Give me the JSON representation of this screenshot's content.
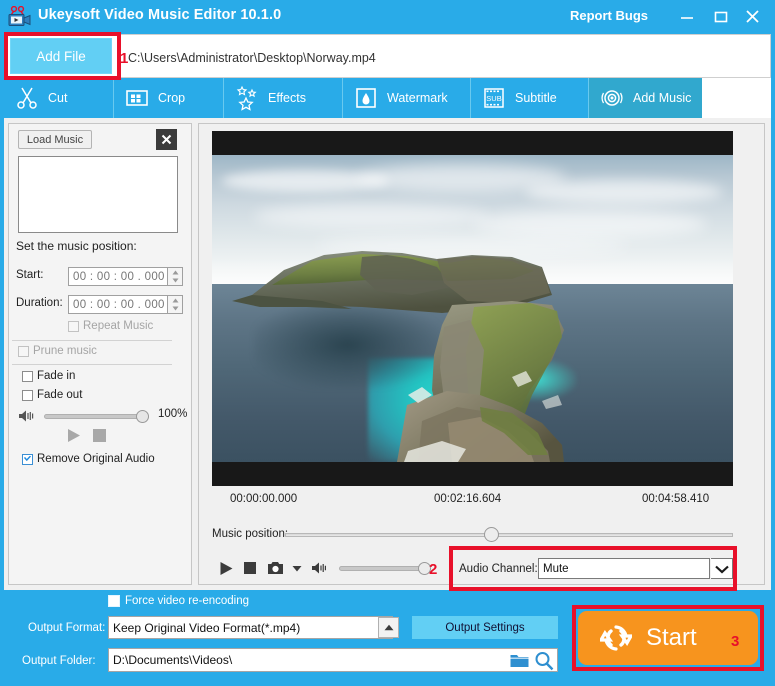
{
  "window": {
    "title": "Ukeysoft Video Music Editor 10.1.0",
    "app_icon": "movie-camera-icon",
    "report_bugs": "Report Bugs",
    "minimize": "minimize-icon",
    "maximize": "maximize-icon",
    "close": "close-icon",
    "header_color": "#29ABE8"
  },
  "file_row": {
    "add_file_label": "Add File",
    "file_path": "C:\\Users\\Administrator\\Desktop\\Norway.mp4"
  },
  "tabs": [
    {
      "label": "Cut",
      "icon": "scissors-icon",
      "active": false
    },
    {
      "label": "Crop",
      "icon": "crop-grid-icon",
      "active": false
    },
    {
      "label": "Effects",
      "icon": "stars-icon",
      "active": false
    },
    {
      "label": "Watermark",
      "icon": "water-drop-icon",
      "active": false
    },
    {
      "label": "Subtitle",
      "icon": "subtitle-film-icon",
      "active": false
    },
    {
      "label": "Add Music",
      "icon": "music-disc-icon",
      "active": true
    }
  ],
  "music_panel": {
    "load_music_label": "Load Music",
    "close_label": "✕",
    "set_position_label": "Set the music position:",
    "start_label": "Start:",
    "start_value": "00 : 00 : 00 . 000",
    "duration_label": "Duration:",
    "duration_value": "00 : 00 : 00 . 000",
    "repeat_music_label": "Repeat Music",
    "repeat_music_checked": false,
    "prune_music_label": "Prune music",
    "prune_music_checked": false,
    "prune_music_disabled": true,
    "fade_in_label": "Fade in",
    "fade_in_checked": false,
    "fade_out_label": "Fade out",
    "fade_out_checked": false,
    "volume_percent": "100%",
    "volume_value": 100,
    "play_icon": "play-icon",
    "stop_icon": "stop-icon",
    "remove_original_audio_label": "Remove Original Audio",
    "remove_original_audio_checked": true
  },
  "preview": {
    "time_start": "00:00:00.000",
    "time_current": "00:02:16.604",
    "time_end": "00:04:58.410",
    "music_position_label": "Music position:",
    "music_position_value": 45,
    "play_icon": "play-icon",
    "stop_icon": "stop-icon",
    "snapshot_icon": "camera-icon",
    "snapshot_dropdown_icon": "triangle-down-icon",
    "volume_icon": "speaker-icon",
    "volume_value": 100,
    "audio_channel_label": "Audio Channel:",
    "audio_channel_value": "Mute",
    "audio_channel_dropdown_icon": "chevron-down-icon"
  },
  "bottom": {
    "force_reencoding_label": "Force video re-encoding",
    "force_reencoding_checked": false,
    "output_format_label": "Output Format:",
    "output_format_value": "Keep Original Video Format(*.mp4)",
    "output_format_dropdown_icon": "triangle-up-icon",
    "output_settings_label": "Output Settings",
    "output_folder_label": "Output Folder:",
    "output_folder_value": "D:\\Documents\\Videos\\",
    "folder_icon": "folder-icon",
    "search_icon": "magnifier-icon",
    "start_label": "Start",
    "start_icon": "refresh-circular-arrows-icon",
    "start_color": "#F7941E"
  },
  "annotations": {
    "step1": "1",
    "step2": "2",
    "step3": "3",
    "color": "#E8102A"
  }
}
